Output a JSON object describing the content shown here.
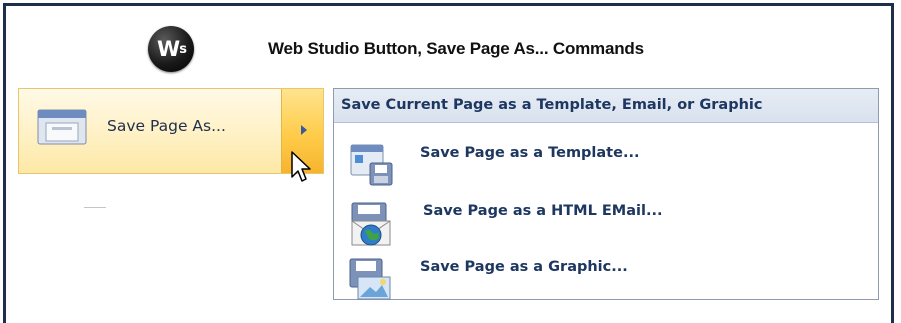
{
  "header": {
    "logo_text": "W",
    "logo_sub": "s",
    "title": "Web Studio Button, Save Page As... Commands"
  },
  "menu": {
    "item_label": "Save Page As...",
    "item_icon": "save-page-icon",
    "has_submenu_arrow": true
  },
  "submenu": {
    "header": "Save Current Page as a Template, Email, or Graphic",
    "items": [
      {
        "label": "Save Page as a Template...",
        "icon": "save-template-icon"
      },
      {
        "label": "Save Page as a HTML EMail...",
        "icon": "save-email-icon"
      },
      {
        "label": "Save Page as a Graphic...",
        "icon": "save-graphic-icon"
      }
    ]
  },
  "colors": {
    "frame_border": "#1d2f49",
    "highlight": "#ffcc4a",
    "menu_text": "#1e3761"
  }
}
